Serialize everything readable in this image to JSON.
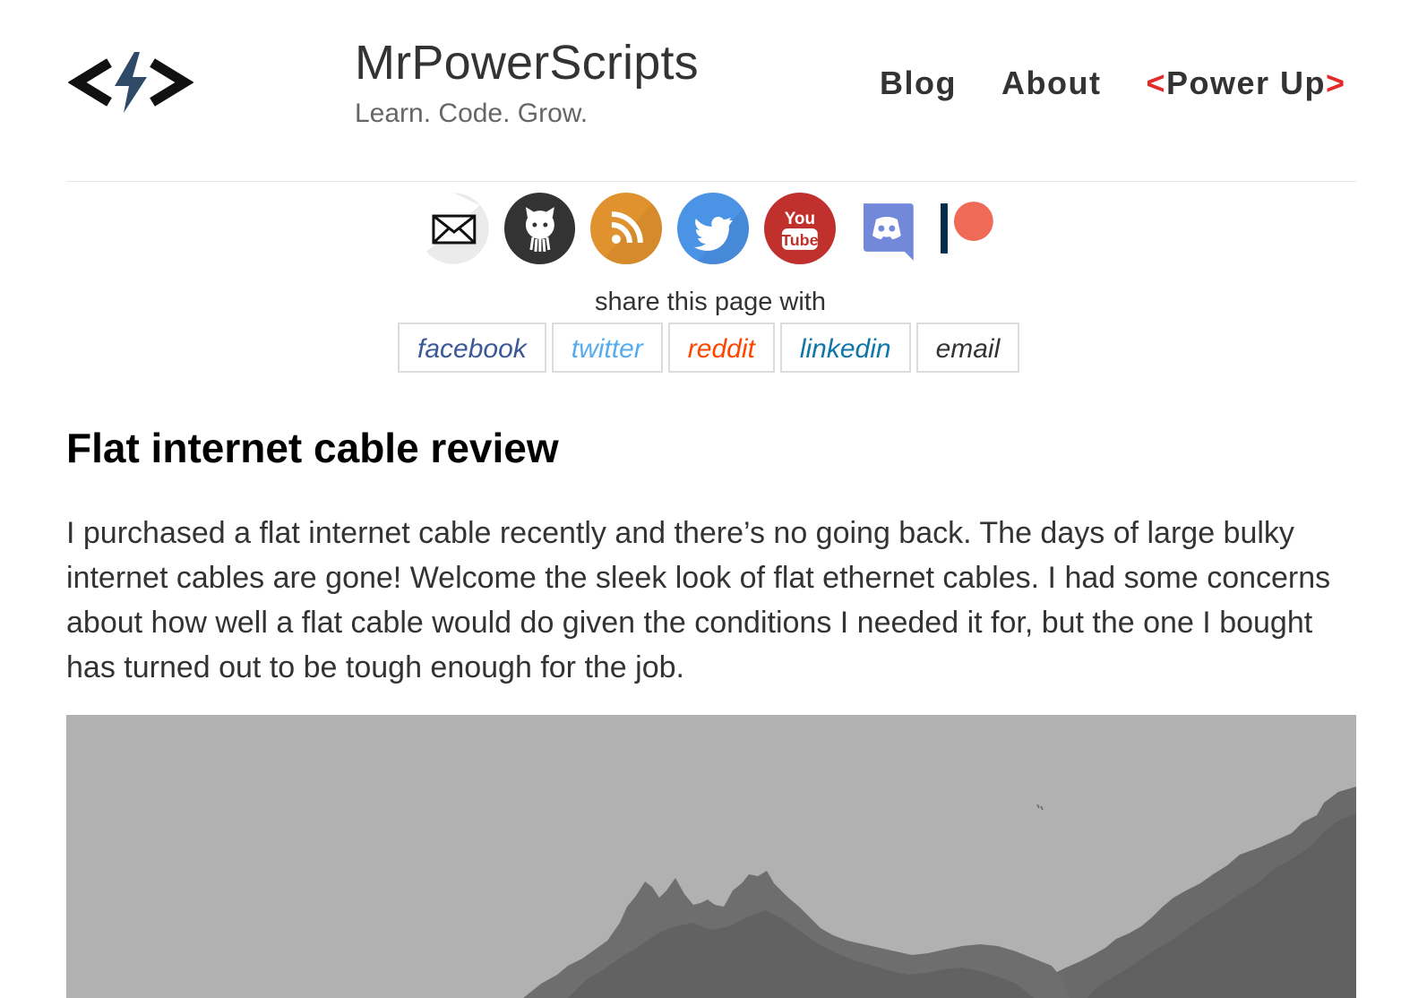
{
  "site": {
    "title": "MrPowerScripts",
    "tagline": "Learn. Code. Grow."
  },
  "nav": {
    "blog": "Blog",
    "about": "About",
    "power_up_open": "<",
    "power_up": "Power Up",
    "power_up_close": ">"
  },
  "social": [
    {
      "icon": "email-icon",
      "color": "#e8e8e8"
    },
    {
      "icon": "github-icon",
      "color": "#333333"
    },
    {
      "icon": "rss-icon",
      "color": "#e0922f"
    },
    {
      "icon": "twitter-icon",
      "color": "#4b93e5"
    },
    {
      "icon": "youtube-icon",
      "color": "#c0302d"
    },
    {
      "icon": "discord-icon",
      "color": "#7289da"
    },
    {
      "icon": "patreon-icon",
      "color": "#f06b57"
    }
  ],
  "share": {
    "label": "share this page with",
    "links": [
      {
        "label": "facebook",
        "color": "#3b5998"
      },
      {
        "label": "twitter",
        "color": "#55acee"
      },
      {
        "label": "reddit",
        "color": "#ff4500"
      },
      {
        "label": "linkedin",
        "color": "#0e76a8"
      },
      {
        "label": "email",
        "color": "#333333"
      }
    ]
  },
  "post": {
    "title": "Flat internet cable review",
    "body": "I purchased a flat internet cable recently and there’s no going back. The days of large bulky internet cables are gone! Welcome the sleek look of flat ethernet cables. I had some concerns about how well a flat cable would do given the conditions I needed it for, but the one I bought has turned out to be tough enough for the job."
  },
  "hero_image": {
    "icon": "mountain-landscape-image"
  }
}
